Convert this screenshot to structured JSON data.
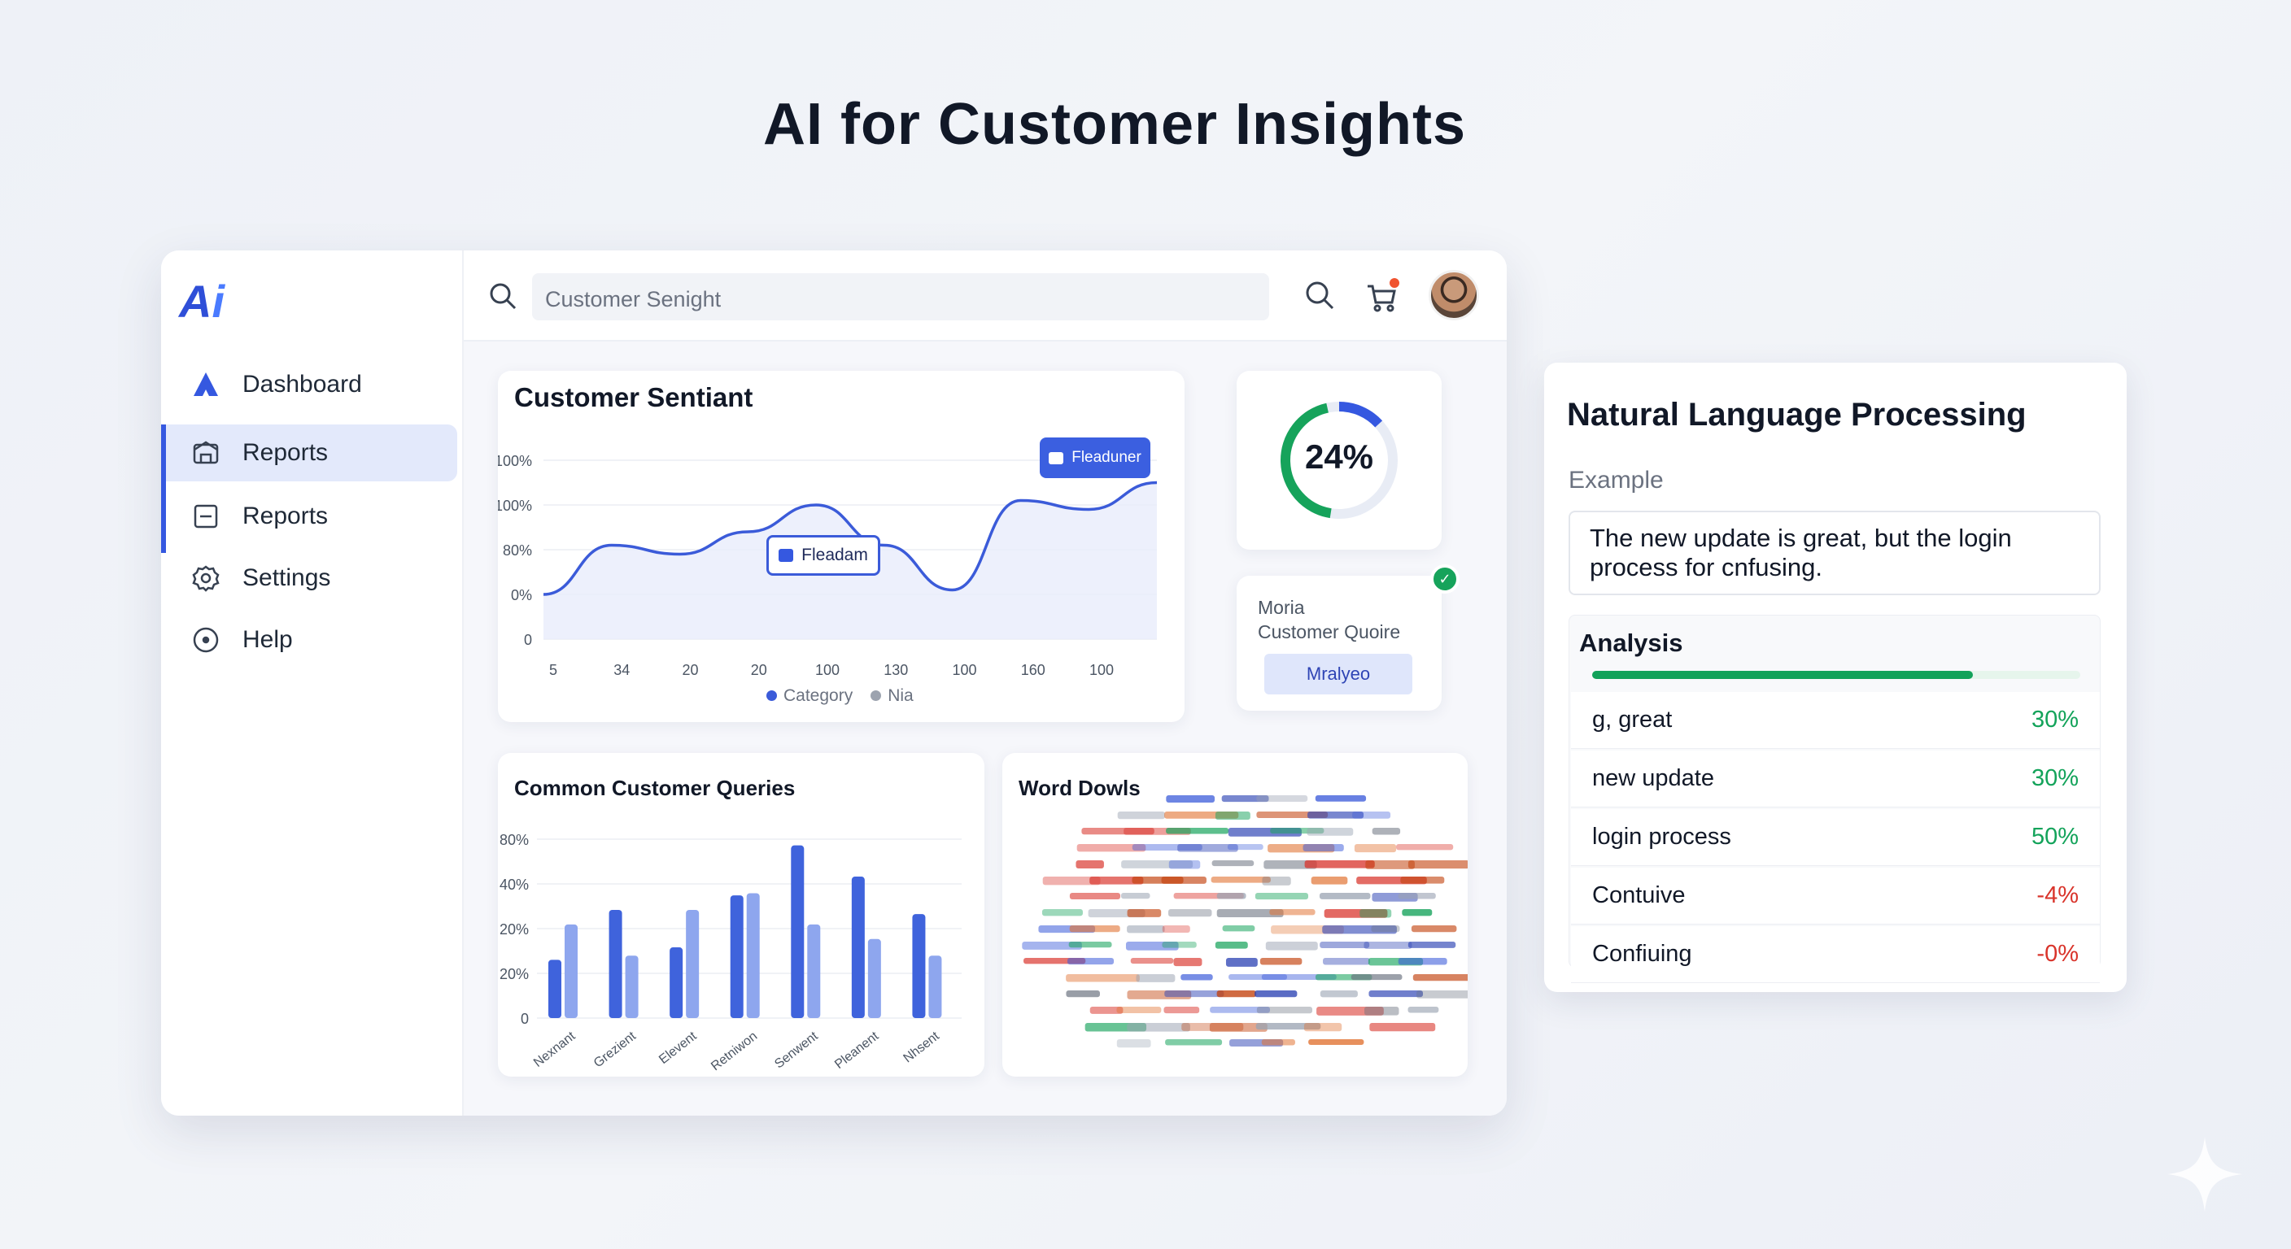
{
  "hero_title": "AI for Customer Insights",
  "logo": {
    "text_a": "A",
    "text_i": "i"
  },
  "sidebar": {
    "items": [
      {
        "label": "Dashboard",
        "icon": "dashboard-icon"
      },
      {
        "label": "Reports",
        "icon": "home-icon",
        "active": true
      },
      {
        "label": "Reports",
        "icon": "document-icon"
      },
      {
        "label": "Settings",
        "icon": "gear-icon"
      },
      {
        "label": "Help",
        "icon": "help-icon"
      }
    ]
  },
  "search": {
    "value": "Customer Senight"
  },
  "colors": {
    "accent": "#3558e0",
    "positive": "#13a35a",
    "negative": "#d9342b"
  },
  "sentiment_card": {
    "title": "Customer Sentiant",
    "tooltip_top": "Fleaduner",
    "tooltip_mid": "Fleadam",
    "legend": [
      "Category",
      "Nia"
    ]
  },
  "gauge": {
    "value_label": "24%",
    "value": 24
  },
  "query_card": {
    "line1": "Moria",
    "line2": "Customer Quoire",
    "button": "Mralyeo"
  },
  "queries_card": {
    "title": "Common Customer Queries"
  },
  "words_card": {
    "title": "Word Dowls"
  },
  "nlp": {
    "title": "Natural Language Processing",
    "example_label": "Example",
    "example_text": "The new update is great, but the login process for cnfusing.",
    "analysis_title": "Analysis",
    "progress": 0.78,
    "rows": [
      {
        "term": "g, great",
        "value": "30%",
        "tone": "pos"
      },
      {
        "term": "new update",
        "value": "30%",
        "tone": "pos"
      },
      {
        "term": "login process",
        "value": "50%",
        "tone": "pos"
      },
      {
        "term": "Contuive",
        "value": "-4%",
        "tone": "neg"
      },
      {
        "term": "Confiuing",
        "value": "-0%",
        "tone": "neg"
      }
    ]
  },
  "chart_data": [
    {
      "type": "area",
      "title": "Customer Sentiant",
      "categories": [
        "5",
        "34",
        "20",
        "20",
        "100",
        "130",
        "100",
        "160",
        "100"
      ],
      "y_ticks": [
        "0",
        "0%",
        "80%",
        "100%",
        "100%"
      ],
      "series": [
        {
          "name": "Category",
          "values": [
            1.0,
            2.1,
            1.9,
            2.4,
            3.0,
            2.1,
            1.1,
            3.1,
            2.9,
            3.5
          ]
        }
      ]
    },
    {
      "type": "bar",
      "title": "Common Customer Queries",
      "categories": [
        "Nexnant",
        "Grezient",
        "Elevent",
        "Retniwon",
        "Senwent",
        "Pleanent",
        "Nhsent"
      ],
      "y_ticks": [
        "0",
        "20%",
        "20%",
        "40%",
        "80%"
      ],
      "series": [
        {
          "name": "light",
          "values": [
            2.25,
            1.5,
            2.6,
            3.0,
            2.25,
            1.9,
            1.5
          ]
        },
        {
          "name": "dark",
          "values": [
            1.4,
            2.6,
            1.7,
            2.95,
            4.15,
            3.4,
            2.5
          ]
        }
      ]
    }
  ]
}
